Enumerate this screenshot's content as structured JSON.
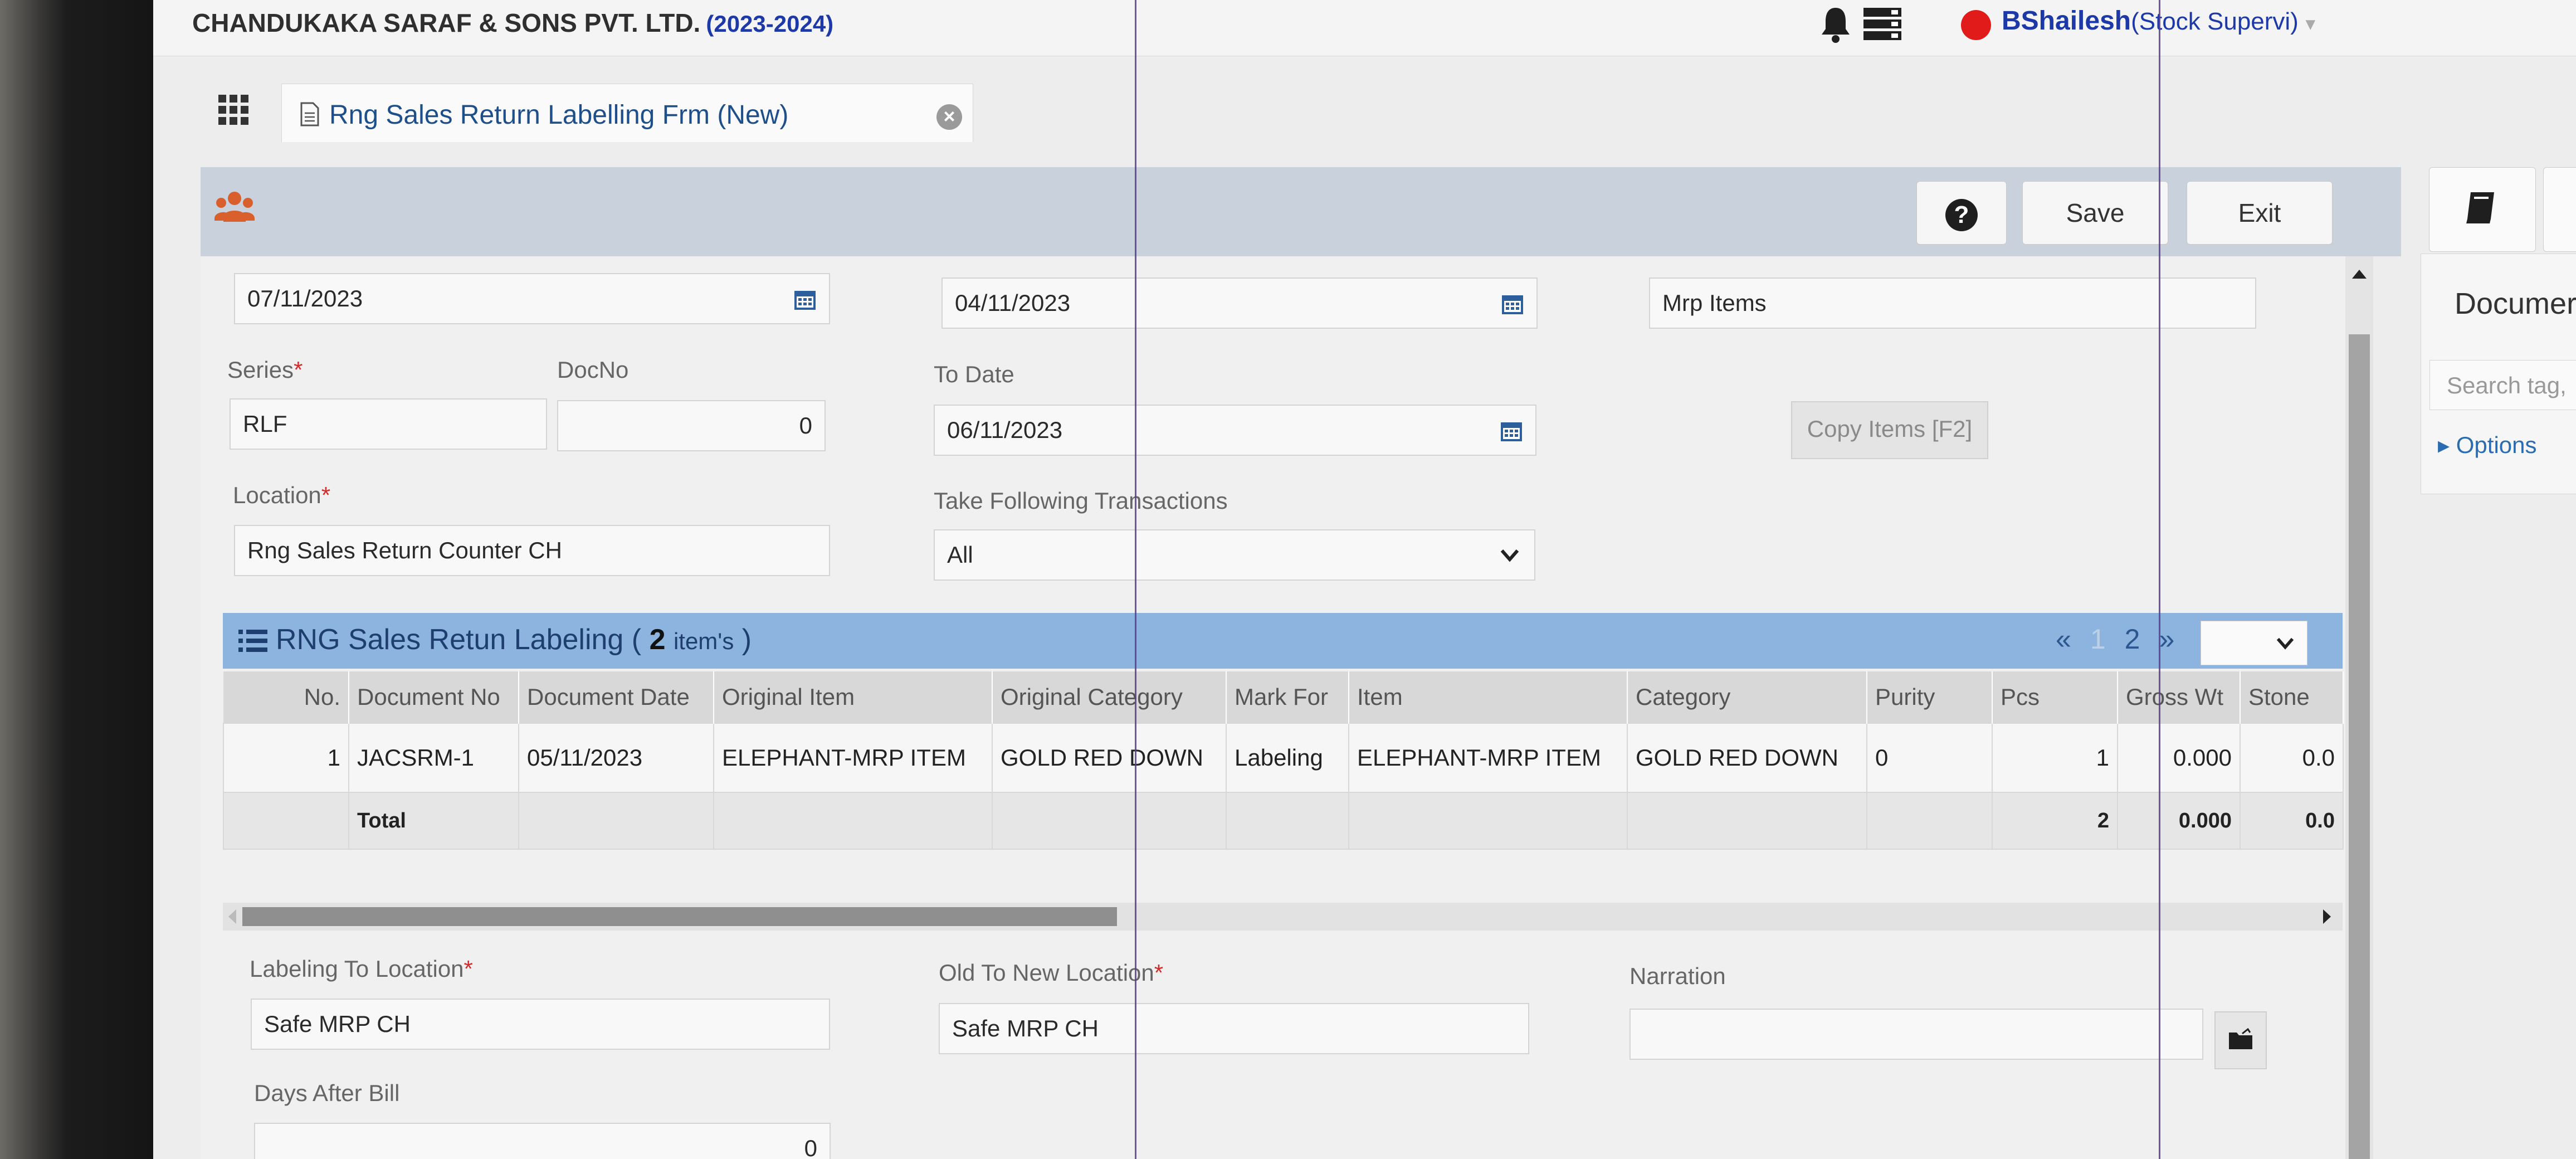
{
  "header": {
    "company": "CHANDUKAKA SARAF & SONS PVT. LTD.",
    "year": "(2023-2024)",
    "user_name": "BShailesh",
    "user_role": "(Stock Supervi)"
  },
  "tab": {
    "label": "Rng Sales Return Labelling Frm (New)"
  },
  "toolbar": {
    "save_label": "Save",
    "exit_label": "Exit"
  },
  "form": {
    "doc_date": "07/11/2023",
    "from_date": "04/11/2023",
    "item_type_value": "Mrp Items",
    "series_label": "Series",
    "series_value": "RLF",
    "docno_label": "DocNo",
    "docno_value": "0",
    "to_date_label": "To Date",
    "to_date_value": "06/11/2023",
    "copy_items_label": "Copy Items [F2]",
    "location_label": "Location",
    "location_value": "Rng Sales Return Counter CH",
    "take_trans_label": "Take Following Transactions",
    "take_trans_value": "All",
    "labeling_to_location_label": "Labeling To Location",
    "labeling_to_location_value": "Safe MRP CH",
    "old_to_new_location_label": "Old To New Location",
    "old_to_new_location_value": "Safe MRP CH",
    "narration_label": "Narration",
    "narration_value": "",
    "days_after_bill_label": "Days After Bill",
    "days_after_bill_value": "0"
  },
  "grid": {
    "title": "RNG Sales Retun Labeling",
    "count": "2",
    "count_suffix": "item's",
    "pager": {
      "first": "«",
      "page1": "1",
      "page2": "2",
      "next": "»"
    },
    "columns": [
      "No.",
      "Document No",
      "Document Date",
      "Original Item",
      "Original Category",
      "Mark For",
      "Item",
      "Category",
      "Purity",
      "Pcs",
      "Gross Wt",
      "Stone"
    ],
    "rows": [
      [
        "1",
        "JACSRM-1",
        "05/11/2023",
        "ELEPHANT-MRP ITEM",
        "GOLD RED DOWN",
        "Labeling",
        "ELEPHANT-MRP ITEM",
        "GOLD RED DOWN",
        "0",
        "1",
        "0.000",
        "0.0"
      ]
    ],
    "total": [
      "",
      "Total",
      "",
      "",
      "",
      "",
      "",
      "",
      "",
      "2",
      "0.000",
      "0.0"
    ]
  },
  "doc_panel": {
    "title": "Documer",
    "search_placeholder": "Search tag,",
    "options_label": "Options"
  },
  "colors": {
    "accent": "#1d39a8",
    "grid_header": "#8db4de",
    "status_dot": "#e11a1a"
  },
  "icons": [
    "bell-icon",
    "stack-icon",
    "grid-menu-icon",
    "document-icon",
    "close-icon",
    "users-icon",
    "help-icon",
    "book-icon",
    "calendar-icon",
    "chevron-down-icon",
    "list-icon",
    "folder-icon"
  ]
}
